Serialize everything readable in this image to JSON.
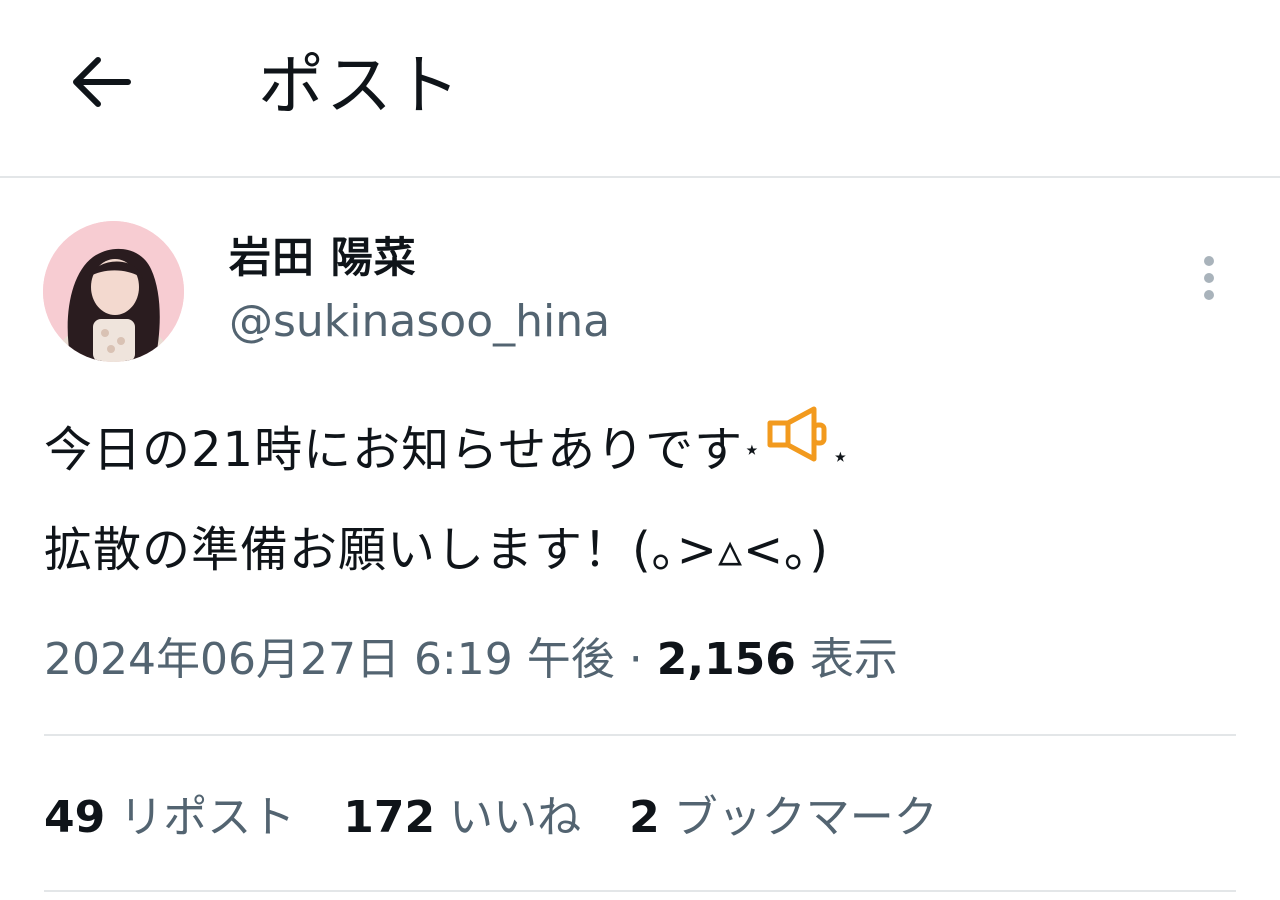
{
  "header": {
    "title": "ポスト",
    "back_icon": "arrow-left-icon"
  },
  "author": {
    "display_name": "岩田 陽菜",
    "handle": "@sukinasoo_hina",
    "avatar_colors": {
      "bg": "#f6c9cf",
      "hair": "#2a1c1f",
      "skin": "#f3d9cf",
      "dress": "#efe4dc"
    }
  },
  "tweet": {
    "line1_text": "今日の21時にお知らせありです",
    "line1_sparkle": "⋆",
    "line1_emoji_icon": "loudspeaker-icon",
    "line1_star": "⋆",
    "line2_text": "拡散の準備お願いします！(｡>▵<｡)"
  },
  "meta": {
    "date": "2024年06月27日 6:19 午後",
    "separator": "·",
    "views_count": "2,156",
    "views_label": "表示"
  },
  "stats": {
    "reposts_count": "49",
    "reposts_label": "リポスト",
    "likes_count": "172",
    "likes_label": "いいね",
    "bookmarks_count": "2",
    "bookmarks_label": "ブックマーク"
  },
  "colors": {
    "text": "#0f1419",
    "secondary": "#536471",
    "divider": "#e3e6e8",
    "more_dots": "#a9b3bb",
    "megaphone": "#f29a1e"
  }
}
